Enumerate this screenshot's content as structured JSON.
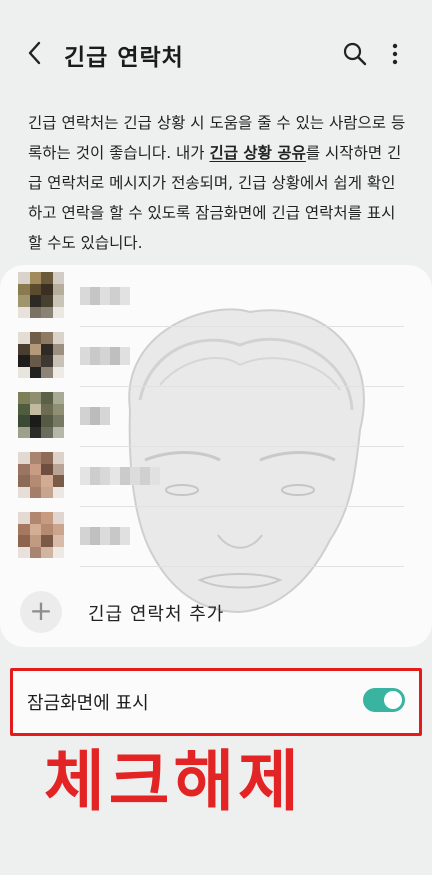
{
  "header": {
    "title": "긴급 연락처",
    "back_icon": "back-arrow-icon",
    "search_icon": "search-icon",
    "more_icon": "more-vert-icon"
  },
  "description": {
    "part1": "긴급 연락처는 긴급 상황 시 도움을 줄 수 있는 사람으로 등록하는 것이 좋습니다. 내가 ",
    "link": "긴급 상황 공유",
    "part2": "를 시작하면 긴급 연락처로 메시지가 전송되며, 긴급 상황에서 쉽게 확인하고 연락을 할 수 있도록 잠금화면에 긴급 연락처를 표시할 수도 있습니다."
  },
  "contacts": {
    "count_shown": 5,
    "names_visible": false
  },
  "add_contact": {
    "label": "긴급 연락처 추가",
    "icon": "plus-icon"
  },
  "lockscreen": {
    "label": "잠금화면에 표시",
    "toggle_on": true
  },
  "annotation": {
    "text": "체크해제",
    "color": "#e32424"
  },
  "colors": {
    "accent": "#39b4a0",
    "highlight_border": "#e31b1b",
    "background": "#eef0f0",
    "card": "#fbfbfb"
  }
}
